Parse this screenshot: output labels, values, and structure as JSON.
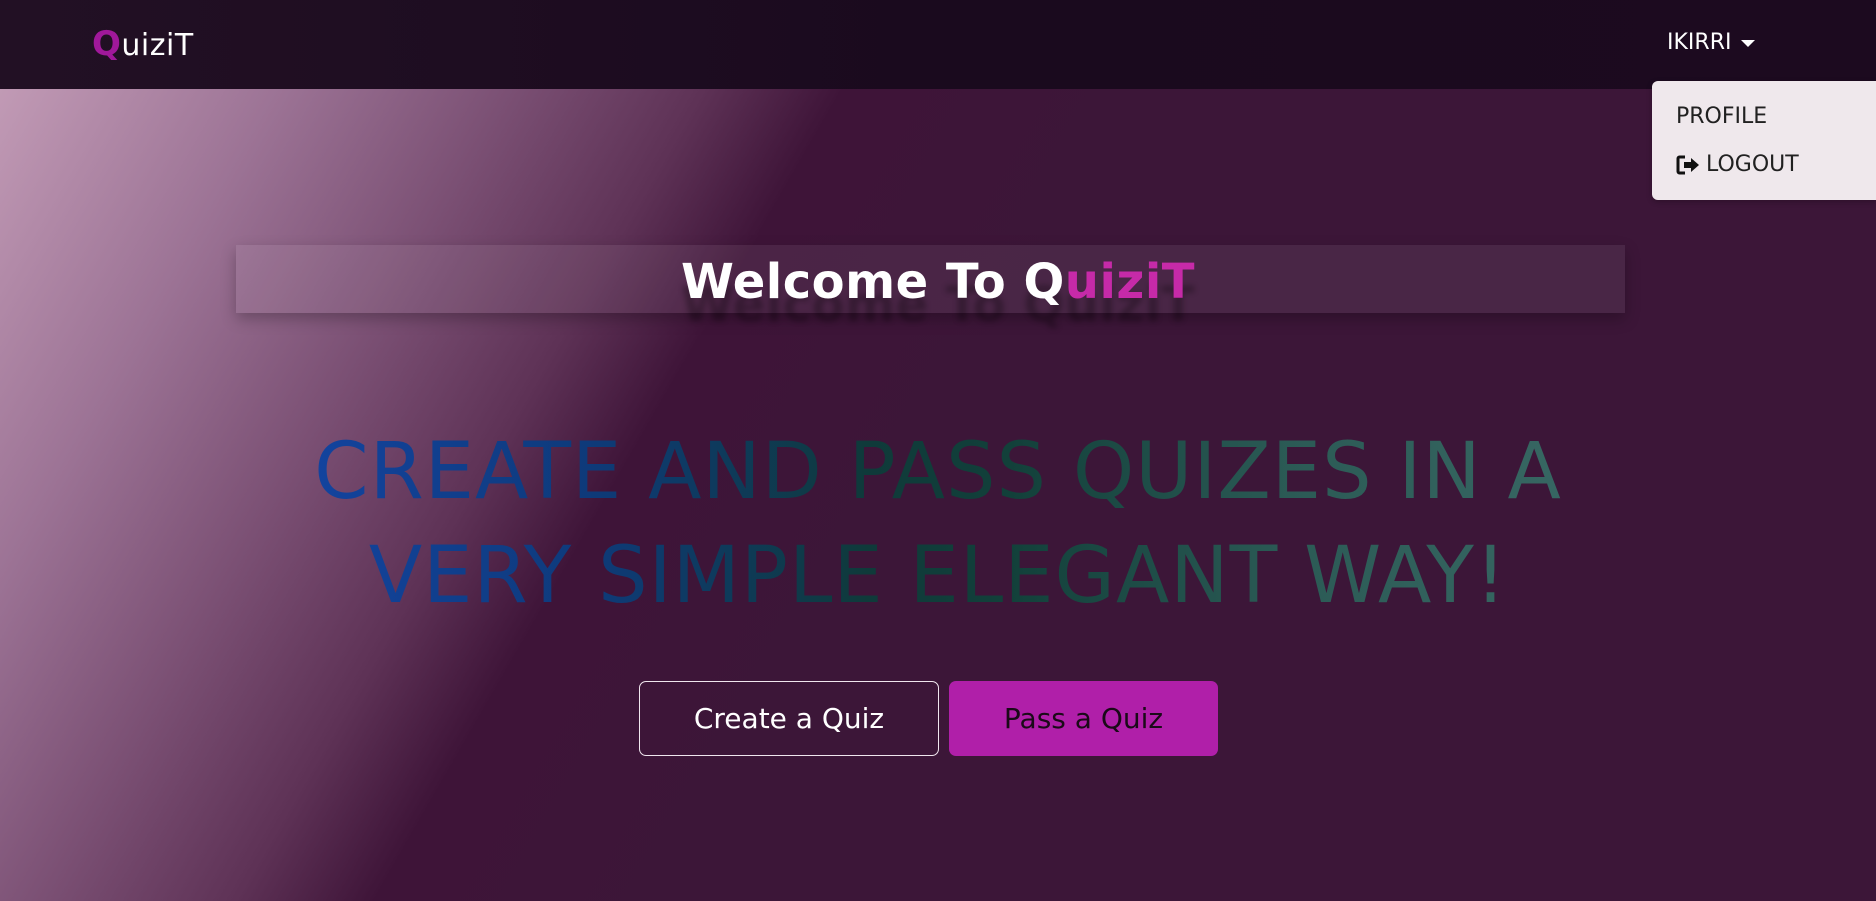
{
  "navbar": {
    "brand_first": "Q",
    "brand_rest": "uiziT",
    "user_name": "IKIRRI"
  },
  "dropdown": {
    "profile_label": "PROFILE",
    "logout_label": "LOGOUT",
    "logout_icon": "sign-out-icon"
  },
  "hero": {
    "welcome_prefix": "Welcome To Q",
    "welcome_accent": "uiziT",
    "tagline": "CREATE AND PASS QUIZES IN A VERY SIMPLE ELEGANT WAY!"
  },
  "buttons": {
    "create_label": "Create a Quiz",
    "pass_label": "Pass a Quiz"
  },
  "colors": {
    "brand_accent": "#a0189a",
    "title_accent": "#c62aa8",
    "pass_button_bg": "#b01fa9",
    "navbar_bg": "#1c0a1f",
    "hero_bg": "#3c1638"
  }
}
